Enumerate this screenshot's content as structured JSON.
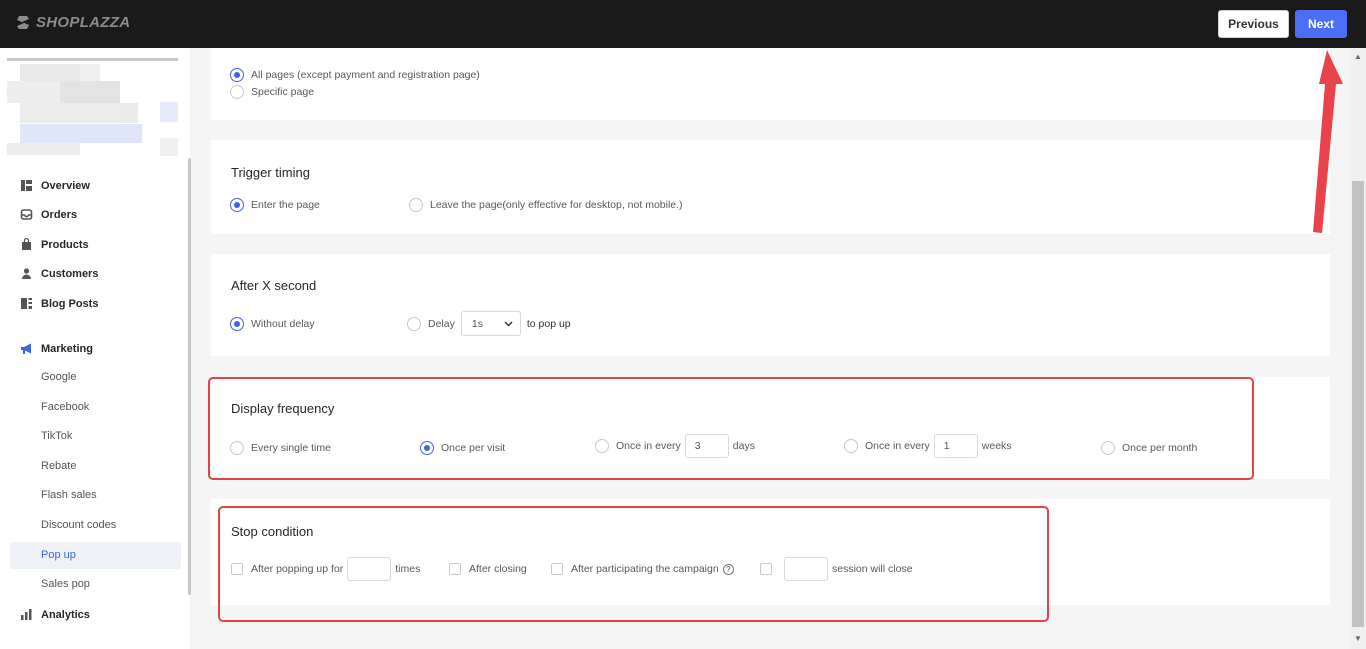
{
  "app": {
    "brand": "SHOPLAZZA"
  },
  "header": {
    "previous_label": "Previous",
    "next_label": "Next"
  },
  "sidebar": {
    "items": [
      {
        "label": "Overview",
        "icon": "dashboard-icon"
      },
      {
        "label": "Orders",
        "icon": "inbox-icon"
      },
      {
        "label": "Products",
        "icon": "bag-icon"
      },
      {
        "label": "Customers",
        "icon": "person-icon"
      },
      {
        "label": "Blog Posts",
        "icon": "document-icon"
      },
      {
        "label": "Marketing",
        "icon": "megaphone-icon"
      }
    ],
    "marketing_sub": [
      "Google",
      "Facebook",
      "TikTok",
      "Rebate",
      "Flash sales",
      "Discount codes",
      "Pop up",
      "Sales pop"
    ],
    "active_sub": "Pop up",
    "analytics": {
      "label": "Analytics",
      "icon": "bar-chart-icon"
    }
  },
  "display_page": {
    "options": [
      "All pages (except payment and registration page)",
      "Specific page"
    ],
    "selected": 0
  },
  "trigger_timing": {
    "title": "Trigger timing",
    "options": [
      "Enter the page",
      "Leave the page(only effective for desktop, not mobile.)"
    ],
    "selected": 0
  },
  "after_x_second": {
    "title": "After X second",
    "without_delay": "Without delay",
    "delay": "Delay",
    "delay_value": "1s",
    "suffix": "to pop up",
    "selected": 0
  },
  "display_frequency": {
    "title": "Display frequency",
    "every_single_time": "Every single time",
    "once_per_visit": "Once per visit",
    "once_in_every": "Once in every",
    "days_value": "3",
    "days": "days",
    "weeks_value": "1",
    "weeks": "weeks",
    "once_per_month": "Once per month",
    "selected": "Once per visit"
  },
  "stop_condition": {
    "title": "Stop condition",
    "after_popping_up_for": "After popping up for",
    "times": "times",
    "after_closing": "After closing",
    "after_participating": "After participating the campaign",
    "help": "?",
    "session_will_close": "session will close"
  },
  "colors": {
    "accent": "#3d63ea",
    "primary_button": "#4c6ef5",
    "highlight": "#e2434b",
    "topbar": "#1a1a1a"
  }
}
